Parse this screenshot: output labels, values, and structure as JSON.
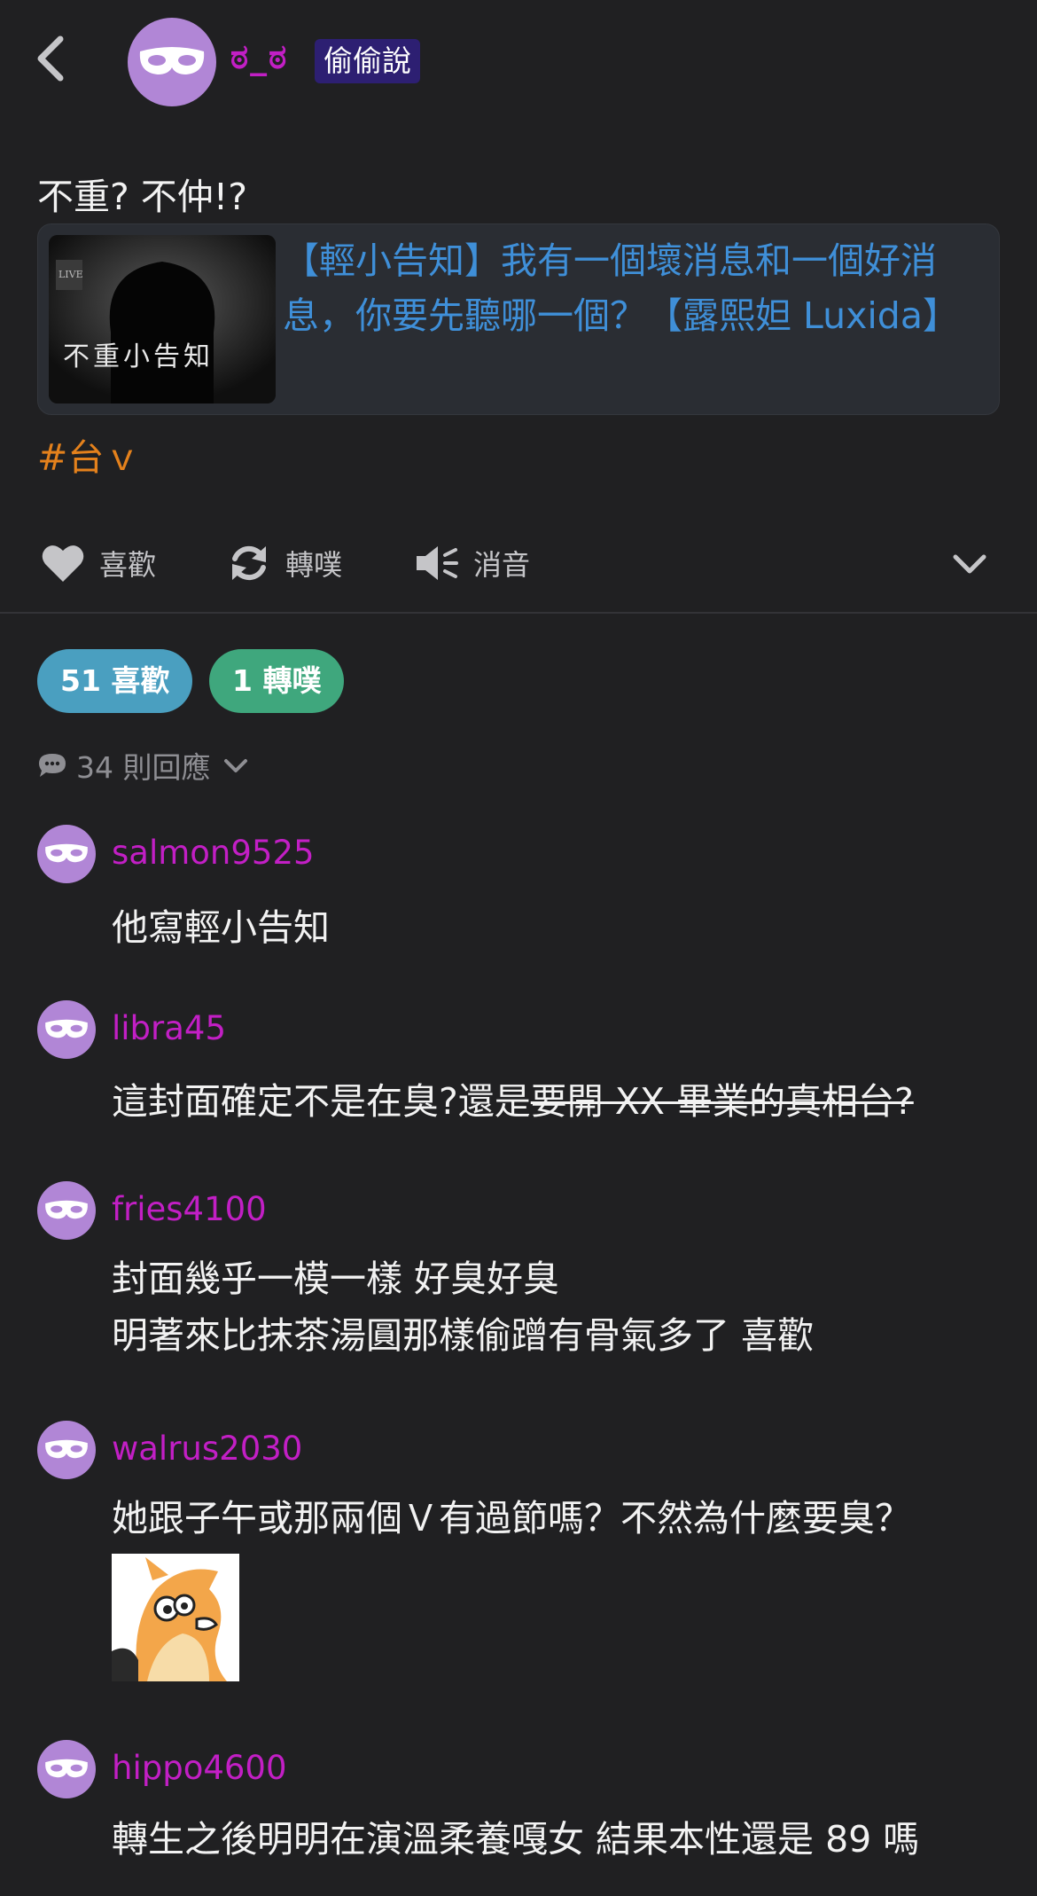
{
  "header": {
    "author_name": "ಠ_ಠ",
    "badge": "偷偷說"
  },
  "post": {
    "text": "不重? 不仲!?",
    "link_title": "【輕小告知】我有一個壞消息和一個好消息，你要先聽哪一個？【露熙妲 Luxida】",
    "thumbnail_live": "LIVE",
    "thumbnail_text": "不重小告知",
    "hashtag": "#台ｖ"
  },
  "actions": {
    "like": "喜歡",
    "replurk": "轉噗",
    "mute": "消音"
  },
  "stats": {
    "likes": "51 喜歡",
    "replurks": "1 轉噗",
    "responses": "34 則回應"
  },
  "comments": [
    {
      "name": "salmon9525",
      "lines": [
        "他寫輕小告知"
      ]
    },
    {
      "name": "libra45",
      "text_normal": "這封面確定不是在臭?還是",
      "text_strike": "要開 XX 畢業的真相台?"
    },
    {
      "name": "fries4100",
      "lines": [
        "封面幾乎一模一樣 好臭好臭",
        "明著來比抹茶湯圓那樣偷蹭有骨氣多了 喜歡"
      ]
    },
    {
      "name": "walrus2030",
      "lines": [
        "她跟子午或那兩個Ｖ有過節嗎？不然為什麼要臭？"
      ]
    },
    {
      "name": "hippo4600",
      "lines": [
        "轉生之後明明在演溫柔養嘎女 結果本性還是 89 嗎"
      ]
    }
  ],
  "colors": {
    "background": "#202022",
    "username": "#c21fc5",
    "link": "#3f8fd8",
    "hashtag": "#e4811c",
    "likes_pill": "#4a9fc0",
    "replurks_pill": "#3fa77d",
    "badge_bg": "#2d1f72"
  }
}
